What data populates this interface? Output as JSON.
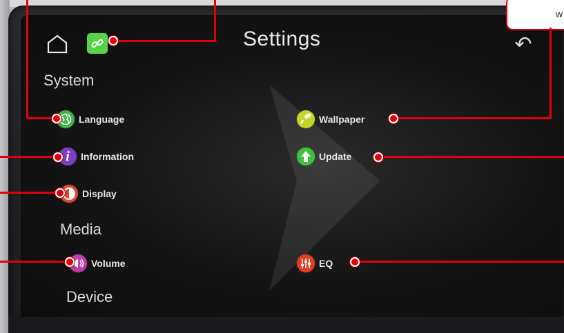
{
  "screen": {
    "title": "Settings",
    "sections": {
      "system": "System",
      "media": "Media",
      "device": "Device"
    },
    "items": {
      "language": "Language",
      "wallpaper": "Wallpaper",
      "information": "Information",
      "update": "Update",
      "display": "Display",
      "volume": "Volume",
      "eq": "EQ"
    },
    "info_glyph": "i",
    "back_glyph": "↶"
  },
  "callout": {
    "text": "w"
  },
  "colors": {
    "language": "#43b14a",
    "wallpaper": "#c3d62a",
    "information": "#7a3fc2",
    "update": "#3ec23a",
    "display": "#e1472b",
    "volume": "#c23aa8",
    "eq": "#e23b22",
    "annotation": "#e3000b"
  }
}
